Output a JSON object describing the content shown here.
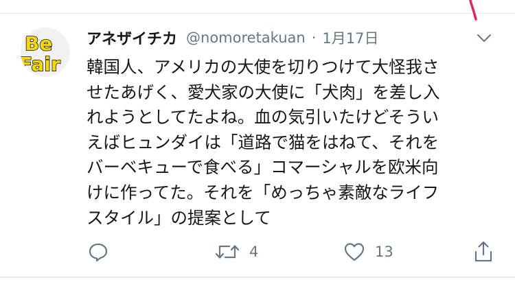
{
  "tweet": {
    "display_name": "アネザイチカ",
    "handle": "@nomoretakuan",
    "separator": "·",
    "date": "1月17日",
    "text_lines": [
      "韓国人、アメリカの大使を切りつけて大怪我さ",
      "せたあげく、愛犬家の大使に「犬肉」を差し入",
      "れようとしてたよね。血の気引いたけどそうい",
      "えばヒュンダイは「道路で猫をはねて、それを",
      "バーベキューで食べる」コマーシャルを欧米向",
      "けに作ってた。それを「めっちゃ素敵なライフ",
      "スタイル」の提案として"
    ]
  },
  "avatar": {
    "line1": "Be",
    "line2": "Fair",
    "bg_color": "#f5d800",
    "text_color": "#111111"
  },
  "actions": {
    "reply_icon": "reply-icon",
    "retweet_icon": "retweet-icon",
    "retweet_count": "4",
    "like_icon": "heart-icon",
    "like_count": "13",
    "share_icon": "share-icon"
  },
  "colors": {
    "text": "#14171a",
    "secondary": "#657786",
    "divider": "#e6ecf0",
    "annotation_red": "#e0245e"
  }
}
